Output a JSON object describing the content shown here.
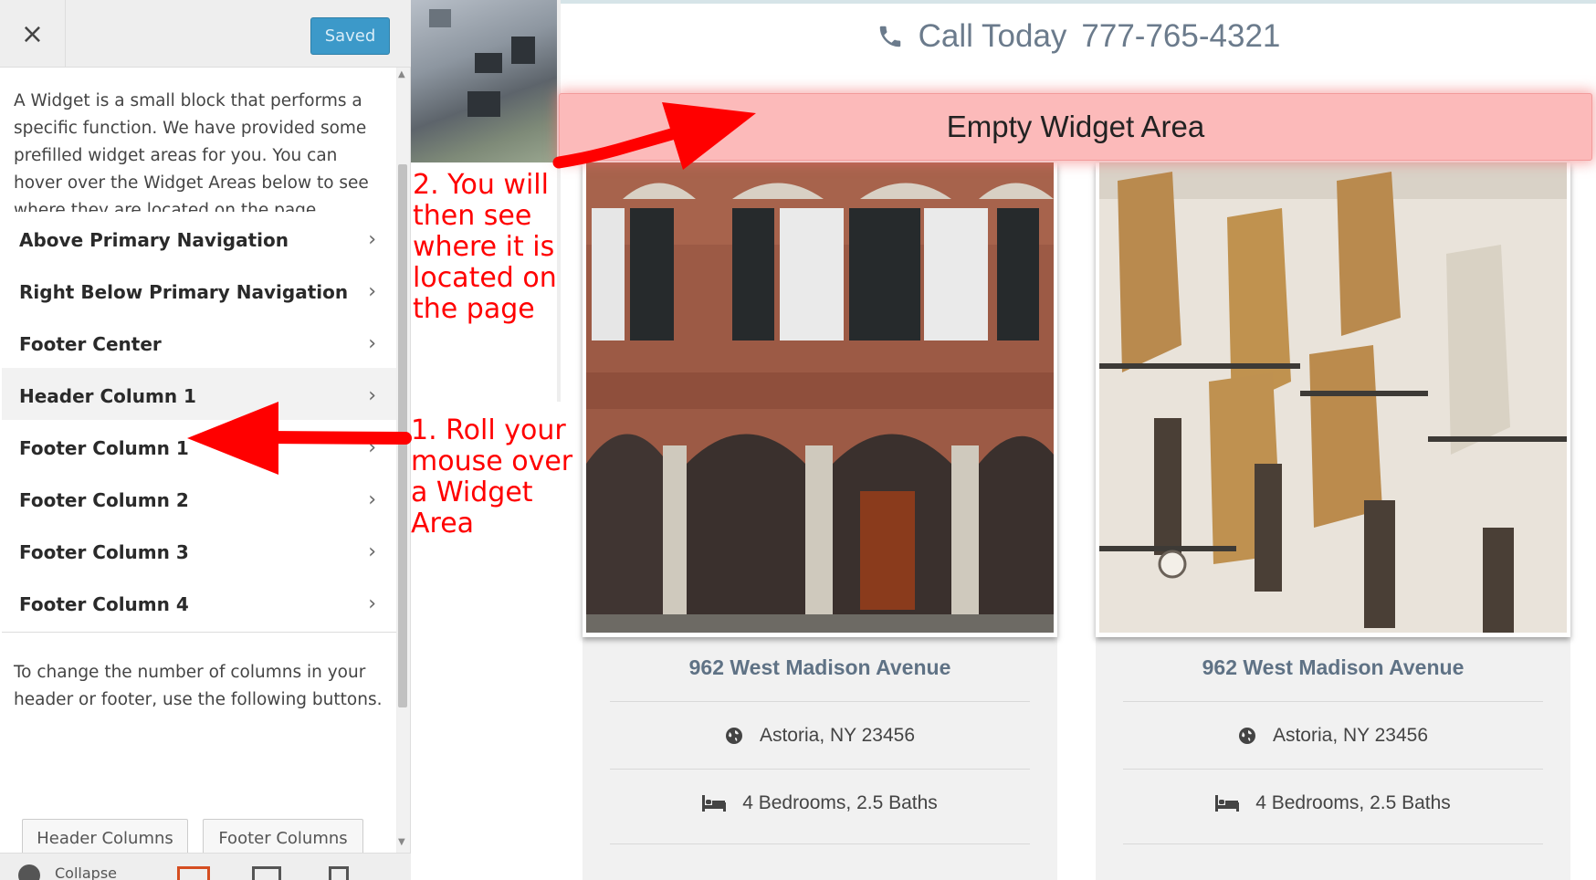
{
  "panel": {
    "close_symbol": "×",
    "saved_label": "Saved",
    "intro": "A Widget is a small block that performs a specific function. We have provided some prefilled widget areas for you. You can hover over the Widget Areas below to see where they are located on the page.",
    "widget_areas": [
      {
        "label": "Above Primary Navigation"
      },
      {
        "label": "Right Below Primary Navigation"
      },
      {
        "label": "Footer Center"
      },
      {
        "label": "Header Column 1"
      },
      {
        "label": "Footer Column 1"
      },
      {
        "label": "Footer Column 2"
      },
      {
        "label": "Footer Column 3"
      },
      {
        "label": "Footer Column 4"
      }
    ],
    "chevron": "›",
    "columns_note": "To change the number of columns in your header or footer, use the following buttons.",
    "header_columns_label": "Header Columns",
    "footer_columns_label": "Footer Columns",
    "collapse_label": "Collapse",
    "icons": [
      "close-icon",
      "chevron-right-icon",
      "collapse-icon",
      "desktop-icon",
      "tablet-icon",
      "mobile-icon"
    ]
  },
  "preview": {
    "call_label": "Call Today",
    "phone": "777-765-4321",
    "widget_area_label": "Empty Widget Area",
    "listings": [
      {
        "address": "962 West Madison Avenue",
        "location": "Astoria, NY 23456",
        "rooms": "4 Bedrooms, 2.5 Baths"
      },
      {
        "address": "962 West Madison Avenue",
        "location": "Astoria, NY 23456",
        "rooms": "4 Bedrooms, 2.5 Baths"
      }
    ],
    "icons": [
      "phone-icon",
      "globe-icon",
      "bed-icon"
    ]
  },
  "annotations": {
    "step1": [
      "1. Roll your",
      "mouse over",
      "a Widget",
      "Area"
    ],
    "step2": [
      "2. You will",
      "then see",
      "where it is",
      "located on",
      "the page"
    ],
    "color": "#ff0000"
  },
  "colors": {
    "saved_button": "#3c99c9",
    "widget_highlight": "#fcbaba",
    "listing_title": "#5f7285",
    "annotation_red": "#ff0000"
  }
}
